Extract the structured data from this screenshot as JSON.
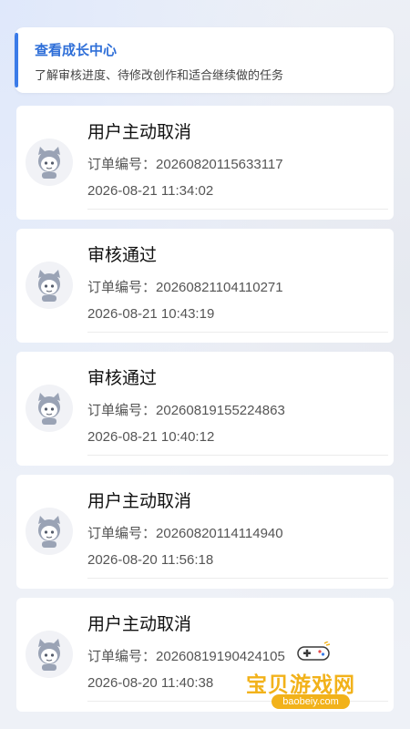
{
  "banner": {
    "title": "查看成长中心",
    "description": "了解审核进度、待修改创作和适合继续做的任务"
  },
  "orders": [
    {
      "status": "用户主动取消",
      "order_label": "订单编号：",
      "order_no": "20260820115633117",
      "time": "2026-08-21 11:34:02"
    },
    {
      "status": "审核通过",
      "order_label": "订单编号：",
      "order_no": "20260821104110271",
      "time": "2026-08-21 10:43:19"
    },
    {
      "status": "审核通过",
      "order_label": "订单编号：",
      "order_no": "20260819155224863",
      "time": "2026-08-21 10:40:12"
    },
    {
      "status": "用户主动取消",
      "order_label": "订单编号：",
      "order_no": "20260820114114940",
      "time": "2026-08-20 11:56:18"
    },
    {
      "status": "用户主动取消",
      "order_label": "订单编号：",
      "order_no": "20260819190424105",
      "time": "2026-08-20 11:40:38"
    }
  ],
  "watermark": {
    "text": "宝贝游戏网",
    "url": "baobeiy.com"
  },
  "colors": {
    "accent": "#3b7be8",
    "watermark": "#f2b21a"
  },
  "icons": {
    "avatar": "cat-ear-child-avatar-icon",
    "watermark": "gamepad-icon"
  }
}
